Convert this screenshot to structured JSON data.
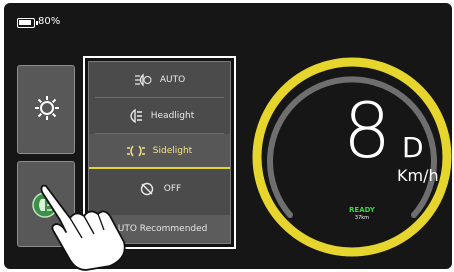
{
  "status": {
    "battery_text": "80%"
  },
  "side_buttons": [
    {
      "icon": "sun-gear-icon"
    },
    {
      "icon": "car-light-icon"
    }
  ],
  "light_menu": {
    "items": [
      {
        "label": "AUTO",
        "icon": "auto-light-icon",
        "selected": false
      },
      {
        "label": "Headlight",
        "icon": "headlight-icon",
        "selected": false
      },
      {
        "label": "Sidelight",
        "icon": "sidelight-icon",
        "selected": true
      },
      {
        "label": "OFF",
        "icon": "light-off-icon",
        "selected": false
      }
    ],
    "footer": "AUTO Recommended"
  },
  "dashboard": {
    "speed": "8",
    "gear": "D",
    "unit": "Km/h",
    "status": "READY",
    "range": "37km"
  },
  "colors": {
    "accent_yellow": "#e6d52d",
    "ready_green": "#39d43f",
    "background": "#161616"
  }
}
